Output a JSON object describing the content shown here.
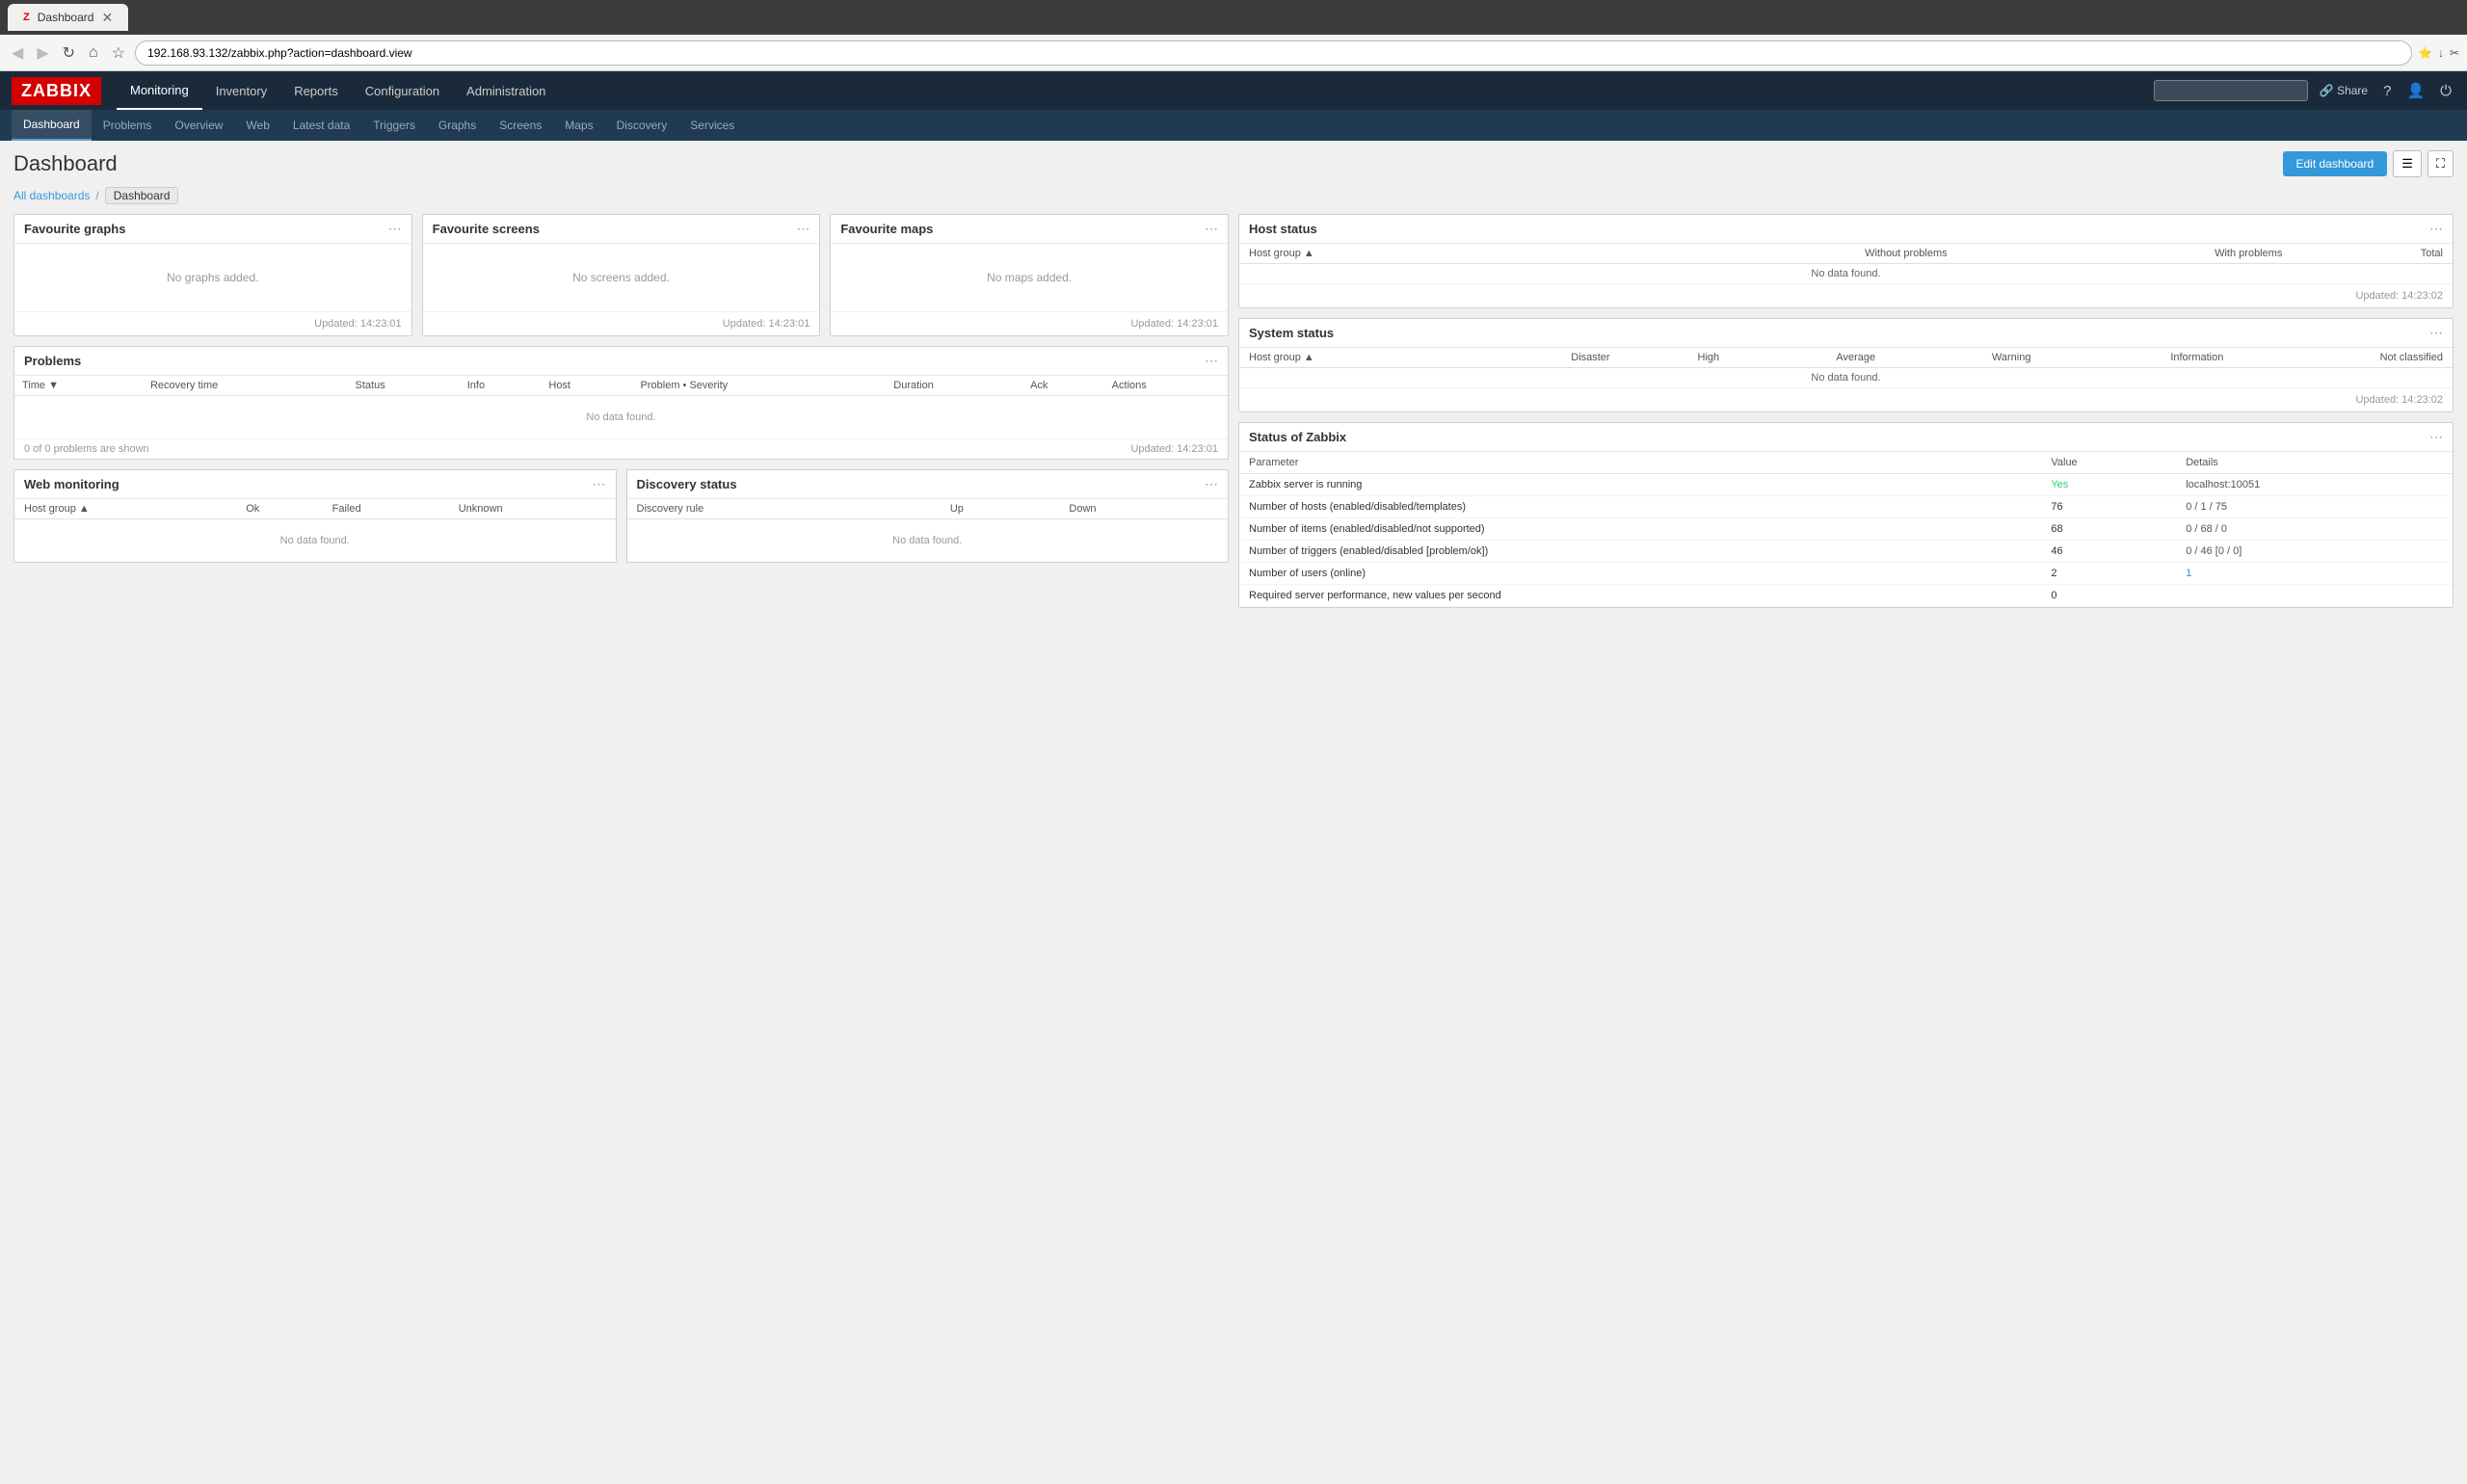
{
  "browser": {
    "tab_title": "Dashboard",
    "url": "192.168.93.132/zabbix.php?action=dashboard.view",
    "nav_buttons": {
      "back": "◀",
      "forward": "▶",
      "refresh": "↻",
      "home": "⌂",
      "bookmark": "☆"
    }
  },
  "app": {
    "logo": "ZABBIX",
    "main_nav": [
      {
        "label": "Monitoring",
        "active": true
      },
      {
        "label": "Inventory",
        "active": false
      },
      {
        "label": "Reports",
        "active": false
      },
      {
        "label": "Configuration",
        "active": false
      },
      {
        "label": "Administration",
        "active": false
      }
    ],
    "header_right": {
      "share_label": "Share",
      "search_placeholder": ""
    },
    "sub_nav": [
      {
        "label": "Dashboard",
        "active": true
      },
      {
        "label": "Problems",
        "active": false
      },
      {
        "label": "Overview",
        "active": false
      },
      {
        "label": "Web",
        "active": false
      },
      {
        "label": "Latest data",
        "active": false
      },
      {
        "label": "Triggers",
        "active": false
      },
      {
        "label": "Graphs",
        "active": false
      },
      {
        "label": "Screens",
        "active": false
      },
      {
        "label": "Maps",
        "active": false
      },
      {
        "label": "Discovery",
        "active": false
      },
      {
        "label": "Services",
        "active": false
      }
    ]
  },
  "page": {
    "title": "Dashboard",
    "edit_dashboard_label": "Edit dashboard",
    "breadcrumbs": [
      {
        "label": "All dashboards",
        "link": true
      },
      {
        "label": "Dashboard",
        "link": false
      }
    ]
  },
  "widgets": {
    "favourite_graphs": {
      "title": "Favourite graphs",
      "no_data": "No graphs added.",
      "updated": "Updated: 14:23:01"
    },
    "favourite_screens": {
      "title": "Favourite screens",
      "no_data": "No screens added.",
      "updated": "Updated: 14:23:01"
    },
    "favourite_maps": {
      "title": "Favourite maps",
      "no_data": "No maps added.",
      "updated": "Updated: 14:23:01"
    },
    "problems": {
      "title": "Problems",
      "columns": [
        "Time ▼",
        "Recovery time",
        "Status",
        "Info",
        "Host",
        "Problem • Severity",
        "Duration",
        "Ack",
        "Actions"
      ],
      "no_data": "No data found.",
      "footer_problems": "0 of 0 problems are shown",
      "updated": "Updated: 14:23:01"
    },
    "host_status": {
      "title": "Host status",
      "columns": [
        "Host group ▲",
        "Without problems",
        "With problems",
        "Total"
      ],
      "no_data": "No data found.",
      "updated": "Updated: 14:23:02"
    },
    "system_status": {
      "title": "System status",
      "columns": [
        "Host group ▲",
        "Disaster",
        "High",
        "Average",
        "Warning",
        "Information",
        "Not classified"
      ],
      "no_data": "No data found.",
      "updated": "Updated: 14:23:02"
    },
    "status_of_zabbix": {
      "title": "Status of Zabbix",
      "col_parameter": "Parameter",
      "col_value": "Value",
      "col_details": "Details",
      "rows": [
        {
          "parameter": "Zabbix server is running",
          "value": "Yes",
          "value_class": "val-yes",
          "details": "localhost:10051"
        },
        {
          "parameter": "Number of hosts (enabled/disabled/templates)",
          "value": "76",
          "value_class": "",
          "details": "0 / 1 / 75"
        },
        {
          "parameter": "Number of items (enabled/disabled/not supported)",
          "value": "68",
          "value_class": "",
          "details": "0 / 68 / 0"
        },
        {
          "parameter": "Number of triggers (enabled/disabled [problem/ok])",
          "value": "46",
          "value_class": "",
          "details": "0 / 46 [0 / 0]"
        },
        {
          "parameter": "Number of users (online)",
          "value": "2",
          "value_class": "",
          "details": "1"
        },
        {
          "parameter": "Required server performance, new values per second",
          "value": "0",
          "value_class": "",
          "details": ""
        }
      ]
    },
    "web_monitoring": {
      "title": "Web monitoring",
      "columns": [
        "Host group ▲",
        "Ok",
        "Failed",
        "Unknown"
      ],
      "no_data": "No data found."
    },
    "discovery_status": {
      "title": "Discovery status",
      "columns": [
        "Discovery rule",
        "Up",
        "Down"
      ],
      "no_data": "No data found."
    }
  },
  "menu_btn_label": "⋯",
  "colors": {
    "accent_blue": "#3498db",
    "zabbix_red": "#d40000",
    "header_dark": "#1b2a3b",
    "sub_nav_dark": "#1f3a52",
    "yes_green": "#2ecc71",
    "link_blue": "#3498db",
    "error_red": "#e74c3c"
  }
}
